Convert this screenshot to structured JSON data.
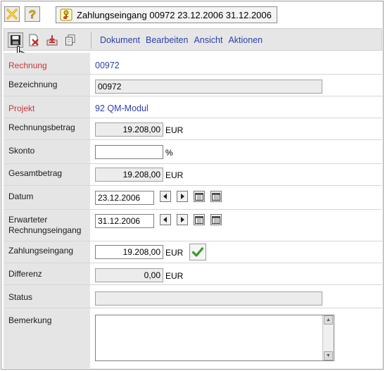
{
  "tab": {
    "title": "Zahlungseingang 00972 23.12.2006 31.12.2006"
  },
  "icons": {
    "close": "close-x-icon",
    "help": "help-question-icon",
    "tab": "payment-key-icon",
    "save": "save-disk-icon",
    "delete": "delete-document-icon",
    "inbox": "inbox-tray-icon",
    "copy": "copy-pages-icon",
    "ok": "checkmark-icon"
  },
  "menu": {
    "dokument": "Dokument",
    "bearbeiten": "Bearbeiten",
    "ansicht": "Ansicht",
    "aktionen": "Aktionen"
  },
  "labels": {
    "rechnung": "Rechnung",
    "bezeichnung": "Bezeichnung",
    "projekt": "Projekt",
    "rechnungsbetrag": "Rechnungsbetrag",
    "skonto": "Skonto",
    "gesamtbetrag": "Gesamtbetrag",
    "datum": "Datum",
    "erwarteter_1": "Erwarteter",
    "erwarteter_2": "Rechnungseingang",
    "zahlungseingang": "Zahlungseingang",
    "differenz": "Differenz",
    "status": "Status",
    "bemerkung": "Bemerkung"
  },
  "values": {
    "rechnung": "00972",
    "bezeichnung": "00972",
    "projekt": "92 QM-Modul",
    "rechnungsbetrag": "19.208,00",
    "skonto": "",
    "gesamtbetrag": "19.208,00",
    "datum": "23.12.2006",
    "erwarteter_rechnungseingang": "31.12.2006",
    "zahlungseingang": "19.208,00",
    "differenz": "0,00",
    "status": "",
    "bemerkung": ""
  },
  "units": {
    "eur": "EUR",
    "percent": "%"
  },
  "colors": {
    "label_required": "#c8343a",
    "link": "#2b3fa8",
    "label_bg": "#e5e5e5",
    "check": "#3a9a2a"
  }
}
